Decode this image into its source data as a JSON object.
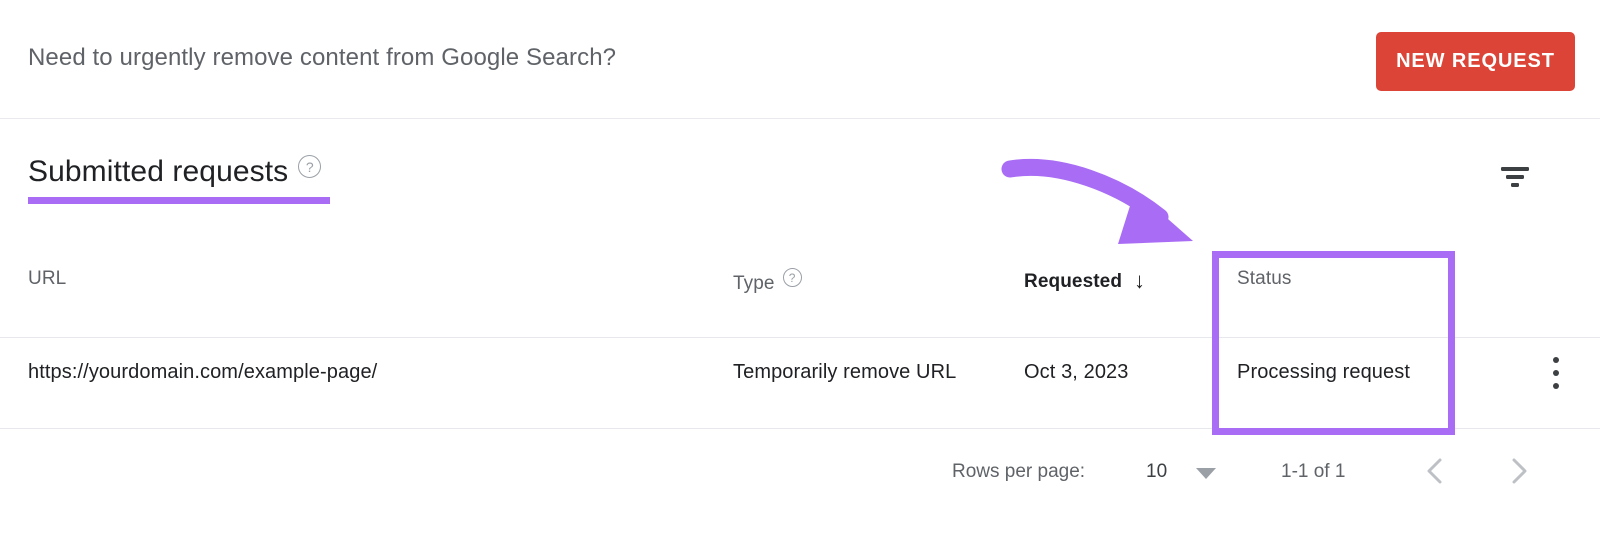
{
  "promo": {
    "message": "Need to urgently remove content from Google Search?",
    "new_request_label": "NEW REQUEST"
  },
  "section": {
    "title": "Submitted requests",
    "help_icon": "help-circle-icon",
    "filter_icon": "filter-list-icon"
  },
  "table": {
    "columns": [
      {
        "key": "url",
        "label": "URL"
      },
      {
        "key": "type",
        "label": "Type",
        "help_icon": "help-circle-icon"
      },
      {
        "key": "requested",
        "label": "Requested",
        "sorted": true,
        "sort_direction": "descending",
        "sort_glyph": "↓"
      },
      {
        "key": "status",
        "label": "Status"
      }
    ],
    "rows": [
      {
        "url": "https://yourdomain.com/example-page/",
        "type": "Temporarily remove URL",
        "requested": "Oct 3, 2023",
        "status": "Processing request",
        "menu_icon": "more-vert-icon"
      }
    ]
  },
  "pagination": {
    "rows_per_page_label": "Rows per page:",
    "rows_per_page_value": "10",
    "rows_per_page_caret": "chevron-down-icon",
    "range": "1-1 of 1",
    "prev_icon": "chevron-left-icon",
    "next_icon": "chevron-right-icon"
  },
  "annotations": {
    "color": "#a96cf5",
    "title_underline": "purple-underline-annotation",
    "arrow": "purple-curved-arrow-annotation",
    "status_box": "purple-highlight-box-annotation"
  },
  "colors": {
    "accent_red": "#db4437",
    "text_primary": "#202124",
    "text_secondary": "#5f6368",
    "divider": "#e8eaed",
    "annotation_purple": "#a96cf5"
  }
}
